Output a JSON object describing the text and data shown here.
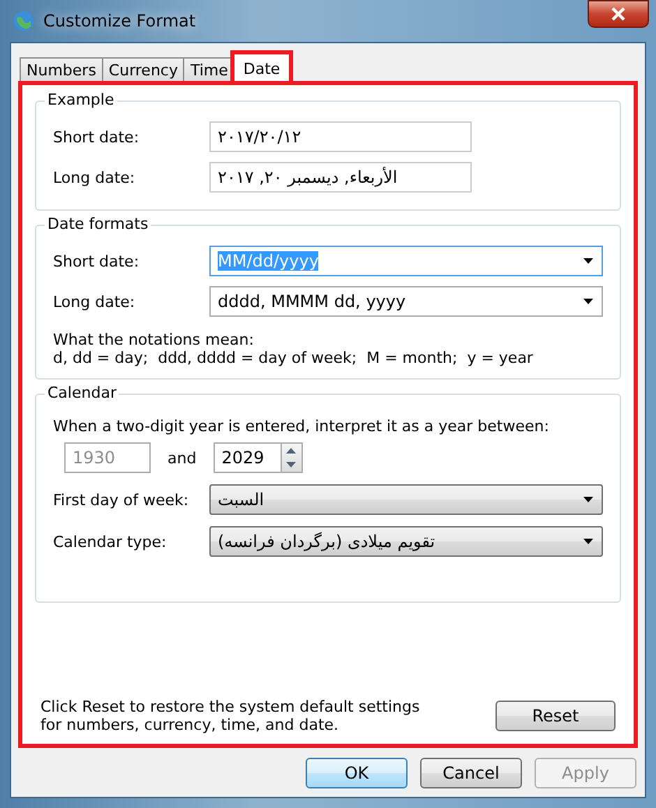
{
  "window": {
    "title": "Customize Format"
  },
  "tabs": [
    {
      "label": "Numbers",
      "selected": false,
      "highlighted": false
    },
    {
      "label": "Currency",
      "selected": false,
      "highlighted": false
    },
    {
      "label": "Time",
      "selected": false,
      "highlighted": false
    },
    {
      "label": "Date",
      "selected": true,
      "highlighted": true
    }
  ],
  "panel": {
    "highlighted": true
  },
  "example": {
    "title": "Example",
    "rows": [
      {
        "label": "Short date:",
        "value": "٢٠١٧/٢٠/١٢"
      },
      {
        "label": "Long date:",
        "value": "الأربعاء, ديسمبر ٢٠, ٢٠١٧"
      }
    ]
  },
  "date_formats": {
    "title": "Date formats",
    "rows": [
      {
        "label": "Short date:",
        "value": "MM/dd/yyyy",
        "focused": true
      },
      {
        "label": "Long date:",
        "value": "dddd, MMMM dd, yyyy",
        "focused": false
      }
    ],
    "notes": [
      "What the notations mean:",
      "d, dd = day;  ddd, dddd = day of week;  M = month;  y = year"
    ]
  },
  "calendar": {
    "title": "Calendar",
    "intro": "When a two-digit year is entered, interpret it as a year between:",
    "from_year": {
      "value": "1930",
      "disabled": true
    },
    "and_label": "and",
    "to_year": {
      "value": "2029",
      "disabled": false
    },
    "rows": [
      {
        "label": "First day of week:",
        "value": "السبت"
      },
      {
        "label": "Calendar type:",
        "value": "تقويم ميلادی (برگردان فرانسه)"
      }
    ]
  },
  "reset": {
    "text": "Click Reset to restore the system default settings for numbers, currency, time, and date.",
    "button": "Reset"
  },
  "buttons": [
    {
      "label": "OK",
      "kind": "default",
      "disabled": false
    },
    {
      "label": "Cancel",
      "kind": "normal",
      "disabled": false
    },
    {
      "label": "Apply",
      "kind": "normal",
      "disabled": true
    }
  ]
}
